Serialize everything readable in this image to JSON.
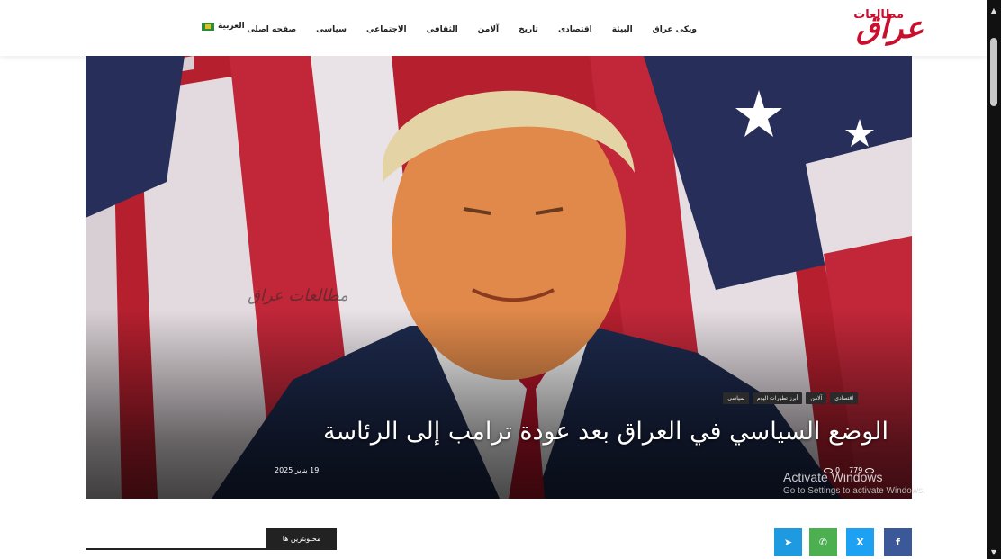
{
  "header": {
    "logo_main": "عراق",
    "logo_sub": "مطالعات",
    "nav": [
      "صفحه اصلی",
      "سیاسی",
      "الاجتماعي",
      "الثقافي",
      "آلامن",
      "تاریخ",
      "اقتصادی",
      "البيئة",
      "ویکی عراق"
    ],
    "language": "العربية"
  },
  "hero": {
    "watermark": "مطالعات عراق",
    "tags": [
      "سیاسی",
      "أبرز تطورات اليوم",
      "آلامن",
      "اقتصادی"
    ],
    "headline": "الوضع السياسي في العراق بعد عودة ترامب إلى الرئاسة",
    "date": "19 يناير 2025",
    "views": "779",
    "comments": "0"
  },
  "section": {
    "title": "محبوبترین ها"
  },
  "share": {
    "facebook": "f",
    "twitter": "X",
    "whatsapp": "✆",
    "telegram": "➤"
  },
  "os_overlay": {
    "title": "Activate Windows",
    "subtitle": "Go to Settings to activate Windows."
  },
  "colors": {
    "brand": "#c8102e",
    "facebook": "#3b5998",
    "twitter": "#1da1f2",
    "whatsapp": "#4caf50",
    "telegram": "#1e9be0"
  }
}
